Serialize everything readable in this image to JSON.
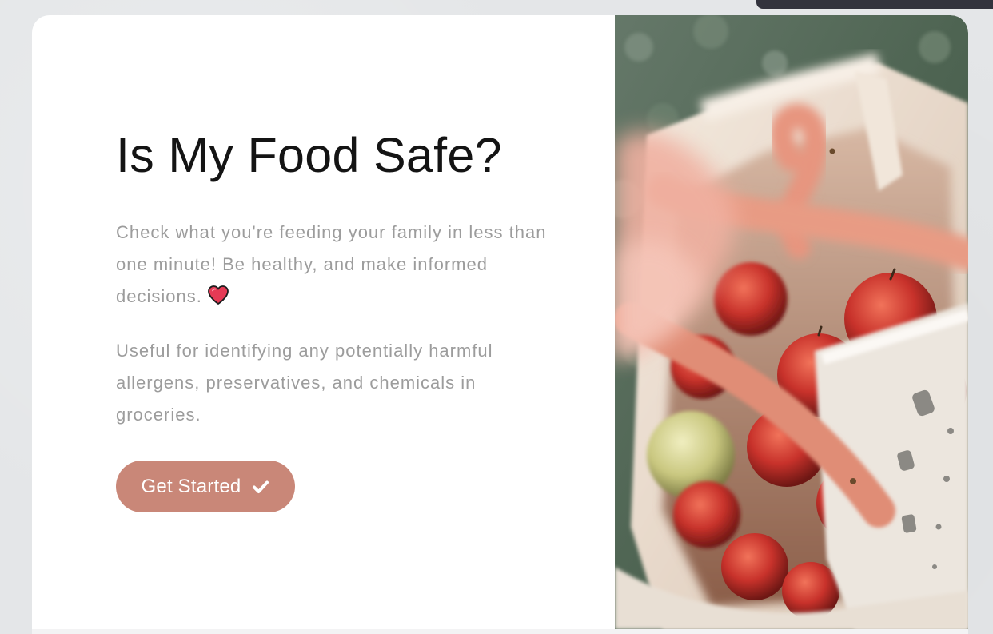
{
  "hero": {
    "title": "Is My Food Safe?",
    "intro": "Check what you're feeding your family in less than one minute! Be healthy, and make informed decisions.",
    "intro_emoji_icon": "heart-icon",
    "detail": "Useful for identifying any potentially harmful allergens, preservatives, and chemicals in groceries.",
    "cta_label": "Get Started",
    "cta_icon": "checkmark-icon"
  },
  "theme": {
    "accent": "#c98778",
    "title_color": "#141414",
    "body_text": "#9c9c9c",
    "page_bg": "#e4e6e8",
    "top_tab": "#32333d"
  }
}
